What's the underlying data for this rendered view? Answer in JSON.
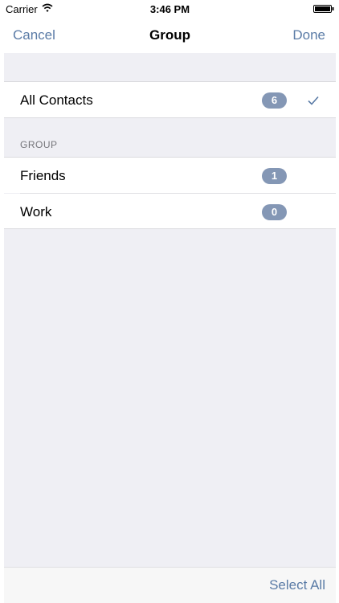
{
  "status_bar": {
    "carrier": "Carrier",
    "time": "3:46 PM"
  },
  "nav": {
    "left_label": "Cancel",
    "title": "Group",
    "right_label": "Done"
  },
  "all_contacts": {
    "label": "All Contacts",
    "count": "6",
    "selected": true
  },
  "group_section": {
    "header": "GROUP",
    "items": [
      {
        "label": "Friends",
        "count": "1"
      },
      {
        "label": "Work",
        "count": "0"
      }
    ]
  },
  "toolbar": {
    "select_all_label": "Select All"
  },
  "colors": {
    "accent": "#5a7ba6",
    "badge": "#8497b5",
    "background": "#efeff4"
  }
}
